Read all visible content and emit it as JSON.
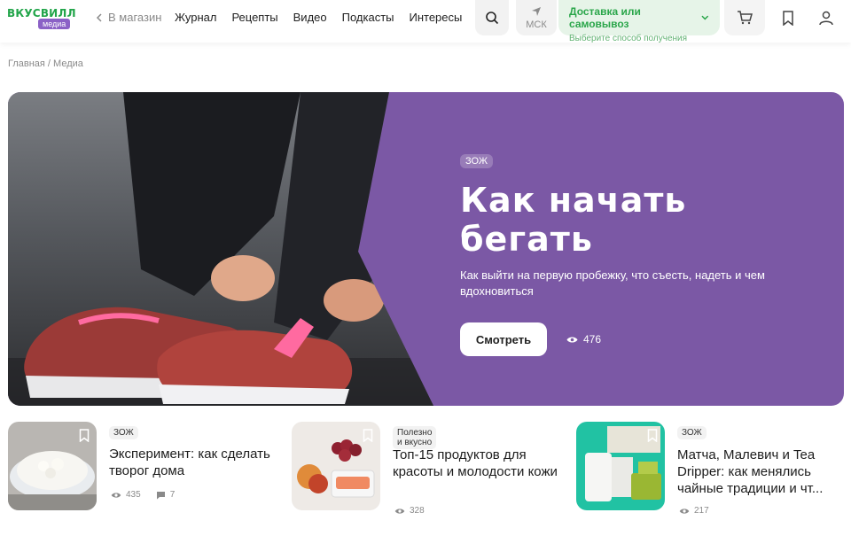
{
  "header": {
    "logo_top": "ВКУСВИЛЛ",
    "logo_badge": "медиа",
    "back_label": "В магазин",
    "nav": [
      "Журнал",
      "Рецепты",
      "Видео",
      "Подкасты",
      "Интересы"
    ],
    "city": "МСК",
    "delivery_title": "Доставка или самовывоз",
    "delivery_sub": "Выберите способ получения"
  },
  "breadcrumb": "Главная / Медиа",
  "hero": {
    "tag": "ЗОЖ",
    "title_line1": "Как начать",
    "title_line2": "бегать",
    "subtitle": "Как выйти на первую пробежку, что съесть, надеть и чем вдохновиться",
    "button": "Смотреть",
    "views": "476"
  },
  "cards": [
    {
      "tag": "ЗОЖ",
      "title": "Эксперимент: как сделать творог дома",
      "views": "435",
      "comments": "7"
    },
    {
      "tag": "Полезно и вкусно",
      "title": "Топ-15 продуктов для красоты и молодости кожи",
      "views": "328"
    },
    {
      "tag": "ЗОЖ",
      "title": "Матча, Малевич и Tea Dripper: как менялись чайные традиции и чт...",
      "views": "217"
    }
  ],
  "colors": {
    "brand_green": "#22a54a",
    "hero_purple": "#7b58a5",
    "badge_purple": "#8b61c6"
  }
}
